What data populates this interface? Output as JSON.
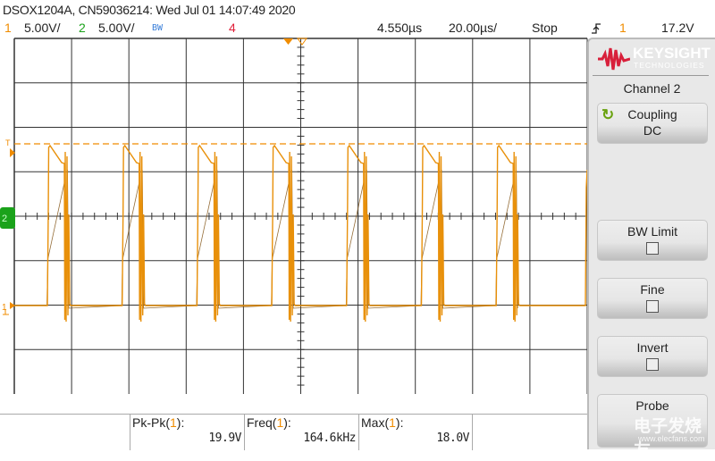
{
  "header": {
    "title": "DSOX1204A, CN59036214: Wed Jul 01 14:07:49 2020",
    "ch1_num": "1",
    "ch1_scale": "5.00V/",
    "ch2_num": "2",
    "ch2_scale": "5.00V/",
    "bw": "BW",
    "ch4_num": "4",
    "delay": "4.550µs",
    "timebase": "20.00µs/",
    "run_state": "Stop",
    "trigger_icon": "rising-edge-icon",
    "trigger_source": "1",
    "trigger_level": "17.2V"
  },
  "colors": {
    "ch1": "#f08c00",
    "ch2": "#1aa21a",
    "bw": "#3a7fd9",
    "ch4": "#e0203a",
    "brand": "#d81f3a"
  },
  "brand": {
    "name": "KEYSIGHT",
    "sub": "TECHNOLOGIES"
  },
  "panel": {
    "title": "Channel 2",
    "buttons": [
      {
        "label": "Coupling",
        "value": "DC",
        "icon": "cycle-icon"
      },
      {
        "label": "BW Limit",
        "checked": false
      },
      {
        "label": "Fine",
        "checked": false
      },
      {
        "label": "Invert",
        "checked": false
      },
      {
        "label": "Probe"
      }
    ]
  },
  "markers": {
    "trigger": "T",
    "ch1": "1",
    "ch2": "2"
  },
  "measurements": [
    {
      "name": "Pk-Pk(",
      "ch": "1",
      "close": "):",
      "value": "19.9V"
    },
    {
      "name": "Freq(",
      "ch": "1",
      "close": "):",
      "value": "164.6kHz"
    },
    {
      "name": "Max(",
      "ch": "1",
      "close": "):",
      "value": "18.0V"
    }
  ],
  "watermark": {
    "text": "电子发烧友",
    "url": "www.elecfans.com"
  }
}
